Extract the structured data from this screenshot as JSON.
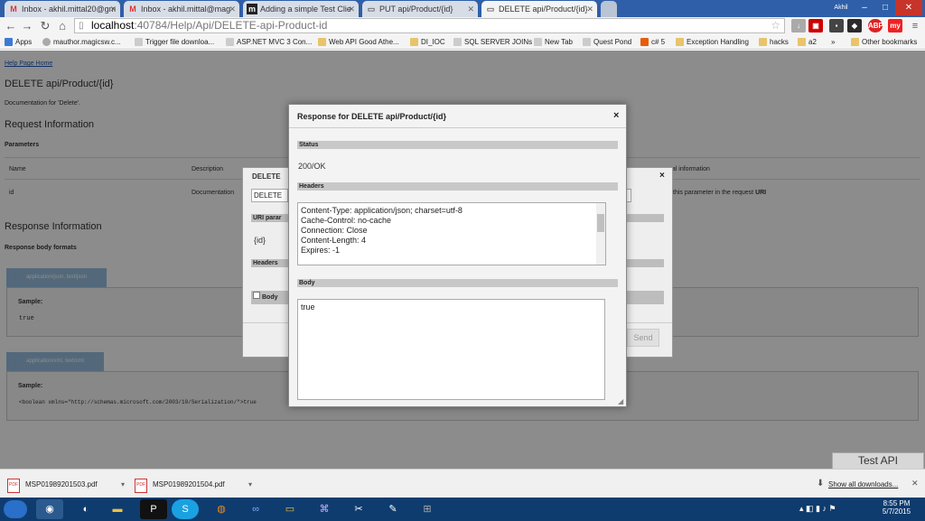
{
  "tabs": [
    {
      "title": "Inbox - akhil.mittal20@gm",
      "icon": "gmail-icon"
    },
    {
      "title": "Inbox - akhil.mittal@mag",
      "icon": "gmail-icon"
    },
    {
      "title": "Adding a simple Test Clie",
      "icon": "m-icon"
    },
    {
      "title": "PUT api/Product/{id}",
      "icon": "page-icon"
    },
    {
      "title": "DELETE api/Product/{id}",
      "icon": "page-icon"
    }
  ],
  "window": {
    "user": "Akhil",
    "minimize": "–",
    "maximize": "□",
    "close": "✕"
  },
  "omnibox": {
    "url_host": "localhost",
    "url_rest": ":40784/Help/Api/DELETE-api-Product-id"
  },
  "extensions": [
    "ABP",
    "my"
  ],
  "bookmarks": [
    {
      "label": "Apps"
    },
    {
      "label": "mauthor.magicsw.c..."
    },
    {
      "label": "Trigger file downloa..."
    },
    {
      "label": "ASP.NET MVC 3 Con..."
    },
    {
      "label": "Web API Good Athe..."
    },
    {
      "label": "DI_IOC"
    },
    {
      "label": "SQL SERVER JOINs"
    },
    {
      "label": "New Tab"
    },
    {
      "label": "Quest Pond"
    },
    {
      "label": "c# 5"
    },
    {
      "label": "Exception Handling"
    },
    {
      "label": "hacks"
    },
    {
      "label": "a2"
    },
    {
      "label": "»"
    },
    {
      "label": "Other bookmarks"
    }
  ],
  "page": {
    "home_link": "Help Page Home",
    "title": "DELETE api/Product/{id}",
    "doc": "Documentation for 'Delete'.",
    "request_info": "Request Information",
    "parameters": "Parameters",
    "col_name": "Name",
    "col_description": "Description",
    "col_additional": "nal information",
    "row_name": "id",
    "row_desc": "Documentation",
    "row_additional": "this parameter in the request",
    "row_additional_bold": "URI",
    "response_info": "Response Information",
    "response_formats": "Response body formats",
    "tab_json": "application/json, text/json",
    "sample_label": "Sample:",
    "sample_json": "true",
    "tab_xml": "application/xml, text/xml",
    "sample_label2": "Sample:",
    "sample_xml": "<boolean xmlns=\"http://schemas.microsoft.com/2003/10/Serialization/\">true",
    "test_api": "Test API"
  },
  "back_dialog": {
    "title": "DELETE",
    "close": "×",
    "method": "DELETE",
    "uri_params": "URI parar",
    "uri_value": "{id}",
    "headers": "Headers",
    "body": "Body",
    "send": "Send"
  },
  "dialog": {
    "title": "Response for DELETE api/Product/{id}",
    "close": "×",
    "status_label": "Status",
    "status_value": "200/OK",
    "headers_label": "Headers",
    "headers": [
      "Content-Type: application/json; charset=utf-8",
      "Cache-Control: no-cache",
      "Connection: Close",
      "Content-Length: 4",
      "Expires: -1"
    ],
    "body_label": "Body",
    "body_value": "true"
  },
  "downloads": [
    {
      "file": "MSP01989201503.pdf"
    },
    {
      "file": "MSP01989201504.pdf"
    }
  ],
  "downloads_show_all": "Show all downloads...",
  "taskbar": {
    "time": "8:55 PM",
    "date": "5/7/2015"
  }
}
